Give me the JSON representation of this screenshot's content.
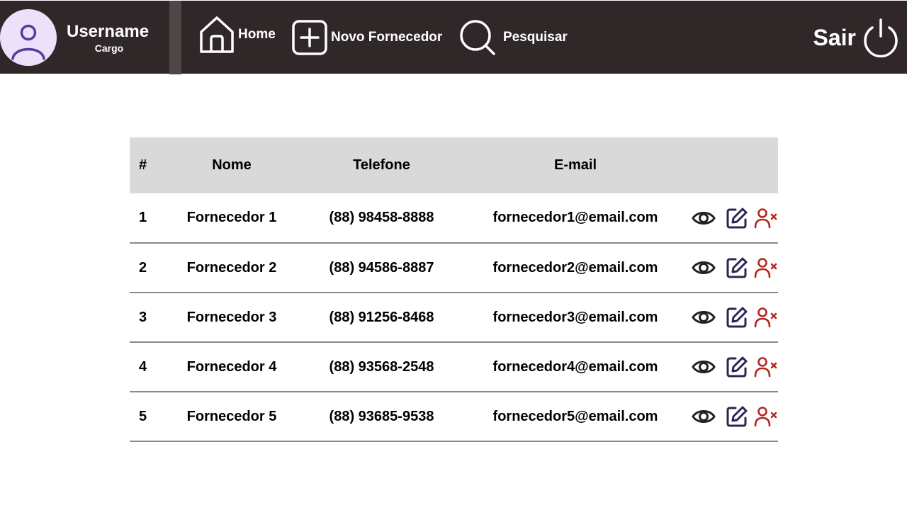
{
  "header": {
    "user": {
      "name": "Username",
      "role": "Cargo"
    },
    "nav": [
      {
        "label": "Home",
        "icon": "home-icon"
      },
      {
        "label": "Novo Fornecedor",
        "icon": "plus-square-icon"
      },
      {
        "label": "Pesquisar",
        "icon": "search-icon"
      }
    ],
    "logout_label": "Sair",
    "logout_icon": "power-icon",
    "colors": {
      "bar": "#302828",
      "avatar_bg": "#ece0fb",
      "avatar_fg": "#5b3a9e"
    }
  },
  "table": {
    "columns": [
      "#",
      "Nome",
      "Telefone",
      "E-mail",
      ""
    ],
    "rows": [
      {
        "num": "1",
        "name": "Fornecedor 1",
        "phone": "(88) 98458-8888",
        "email": "fornecedor1@email.com"
      },
      {
        "num": "2",
        "name": "Fornecedor 2",
        "phone": "(88) 94586-8887",
        "email": "fornecedor2@email.com"
      },
      {
        "num": "3",
        "name": "Fornecedor 3",
        "phone": "(88) 91256-8468",
        "email": "fornecedor3@email.com"
      },
      {
        "num": "4",
        "name": "Fornecedor 4",
        "phone": "(88) 93568-2548",
        "email": "fornecedor4@email.com"
      },
      {
        "num": "5",
        "name": "Fornecedor 5",
        "phone": "(88) 93685-9538",
        "email": "fornecedor5@email.com"
      }
    ],
    "row_actions": [
      {
        "icon": "eye-icon",
        "color": "#222222"
      },
      {
        "icon": "edit-icon",
        "color": "#2e2453"
      },
      {
        "icon": "user-remove-icon",
        "color": "#b3261e"
      }
    ],
    "colors": {
      "header_bg": "#d9d9d9",
      "row_border": "#8a8a8a"
    }
  }
}
